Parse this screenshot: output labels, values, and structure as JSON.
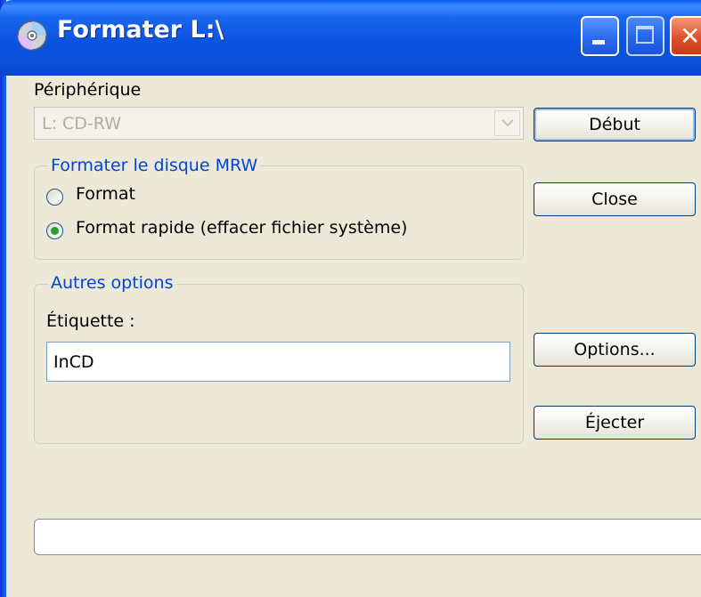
{
  "window": {
    "title": "Formater L:\\"
  },
  "device": {
    "label": "Périphérique",
    "selected": "L: CD-RW"
  },
  "format_group": {
    "legend": "Formater le disque MRW",
    "options": [
      {
        "label": "Format",
        "checked": false
      },
      {
        "label": "Format rapide (effacer fichier système)",
        "checked": true
      }
    ]
  },
  "other_group": {
    "legend": "Autres options",
    "label_caption": "Étiquette :",
    "label_value": "InCD"
  },
  "buttons": {
    "start": "Début",
    "close": "Close",
    "options": "Options...",
    "eject": "Éjecter"
  },
  "progress": {
    "value": 0
  },
  "colors": {
    "titlebar": "#0a54e0",
    "dialog_bg": "#ece9d8",
    "group_legend": "#0046d5",
    "close_button": "#e04f2a",
    "radio_dot": "#21a121"
  }
}
